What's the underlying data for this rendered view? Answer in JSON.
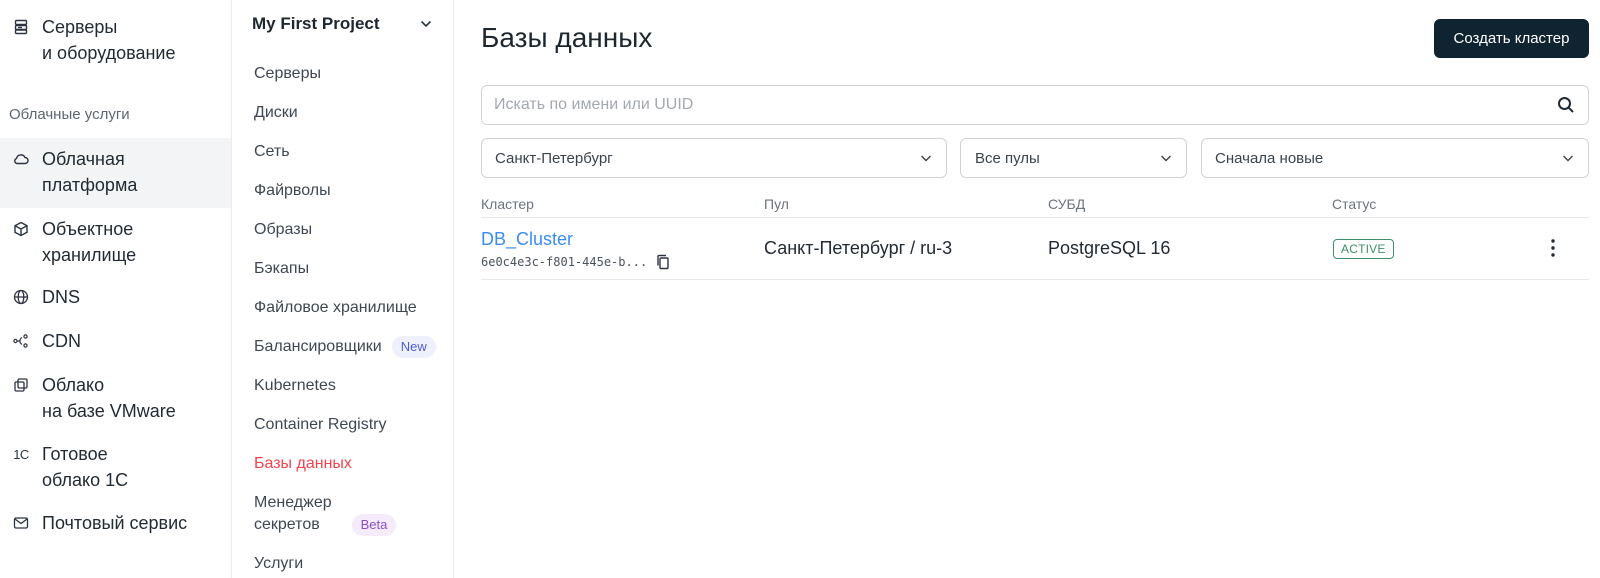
{
  "left_nav": {
    "items_top": [
      {
        "icon": "server-icon",
        "label": "Серверы\nи оборудование"
      }
    ],
    "section_label": "Облачные услуги",
    "items": [
      {
        "icon": "cloud-icon",
        "label": "Облачная\nплатформа",
        "active": true
      },
      {
        "icon": "cube-icon",
        "label": "Объектное\nхранилище"
      },
      {
        "icon": "globe-icon",
        "label": "DNS"
      },
      {
        "icon": "nodes-icon",
        "label": "CDN"
      },
      {
        "icon": "stack-icon",
        "label": "Облако\nна базе VMware"
      },
      {
        "icon": "1c-icon",
        "icon_text": "1C",
        "label": "Готовое\nоблако 1С"
      },
      {
        "icon": "mail-icon",
        "label": "Почтовый сервис"
      }
    ]
  },
  "project_nav": {
    "project_name": "My First Project",
    "items": [
      {
        "label": "Серверы"
      },
      {
        "label": "Диски"
      },
      {
        "label": "Сеть"
      },
      {
        "label": "Файрволы"
      },
      {
        "label": "Образы"
      },
      {
        "label": "Бэкапы"
      },
      {
        "label": "Файловое хранилище"
      },
      {
        "label": "Балансировщики",
        "badge": "New"
      },
      {
        "label": "Kubernetes"
      },
      {
        "label": "Container Registry"
      },
      {
        "label": "Базы данных",
        "active": true
      },
      {
        "label": "Менеджер\nсекретов",
        "badge": "Beta"
      },
      {
        "label": "Услуги"
      }
    ]
  },
  "main": {
    "title": "Базы данных",
    "create_button": "Создать кластер",
    "search": {
      "placeholder": "Искать по имени или UUID",
      "value": ""
    },
    "filters": {
      "region": "Санкт-Петербург",
      "pool": "Все пулы",
      "sort": "Сначала новые"
    },
    "table": {
      "columns": [
        "Кластер",
        "Пул",
        "СУБД",
        "Статус"
      ],
      "rows": [
        {
          "name": "DB_Cluster",
          "uuid": "6e0c4e3c-f801-445e-b...",
          "pool": "Санкт-Петербург / ru-3",
          "dbms": "PostgreSQL 16",
          "status": "ACTIVE"
        }
      ]
    }
  },
  "colors": {
    "accent_active": "#ef4550",
    "link": "#3b8cf0",
    "primary_button": "#0f2330",
    "status_active": "#3d8e6a"
  }
}
